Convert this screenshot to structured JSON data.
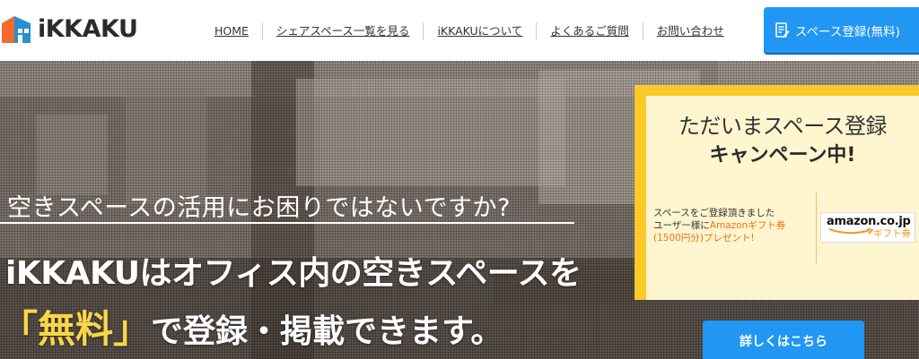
{
  "header": {
    "logo_text": "iKKAKU",
    "nav": [
      {
        "label": "HOME"
      },
      {
        "label": "シェアスペース一覧を見る"
      },
      {
        "label": "iKKAKUについて"
      },
      {
        "label": "よくあるご質問"
      },
      {
        "label": "お問い合わせ"
      }
    ],
    "cta_label": "スペース登録(無料)",
    "cta_icon": "form-edit-icon"
  },
  "hero": {
    "sub_heading": "空きスペースの活用にお困りではないですか?",
    "main_line1": "iKKAKUはオフィス内の空きスペースを",
    "main_line2_highlight": "「無料」",
    "main_line2_rest": "で登録・掲載できます。"
  },
  "campaign": {
    "title_line1": "ただいまスペース登録",
    "title_line2": "キャンペーン中!",
    "desc_line1": "スペースをご登録頂きました",
    "desc_line2_a": "ユーザー様に",
    "desc_line2_b": "Amazonギフト券",
    "desc_line3": "(1500円分)プレゼント!",
    "amazon_logo": "amazon.co.jp",
    "amazon_sub": "ギフト券",
    "detail_button": "詳しくはこちら"
  },
  "colors": {
    "accent_blue": "#2196f3",
    "campaign_yellow": "#fcc82a",
    "highlight_yellow": "#f9d648",
    "orange": "#e8751a"
  }
}
